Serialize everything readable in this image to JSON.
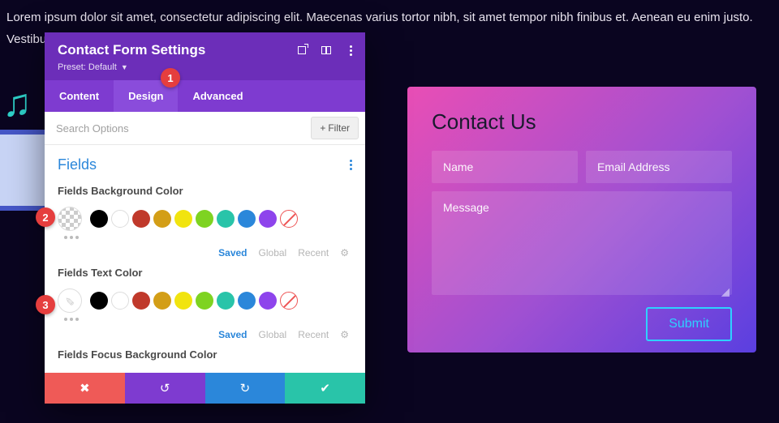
{
  "lorem": "Lorem ipsum dolor sit amet, consectetur adipiscing elit. Maecenas varius tortor nibh, sit amet tempor nibh finibus et. Aenean eu enim justo. Vestibulum aliquam hendrerit",
  "panel": {
    "title": "Contact Form Settings",
    "preset_label": "Preset:",
    "preset_value": "Default",
    "tabs": {
      "content": "Content",
      "design": "Design",
      "advanced": "Advanced"
    },
    "search_placeholder": "Search Options",
    "filter_label": "Filter",
    "section_title": "Fields",
    "fields_bg_label": "Fields Background Color",
    "fields_text_label": "Fields Text Color",
    "fields_focus_bg_label": "Fields Focus Background Color",
    "swatches": {
      "palette": [
        "#000000",
        "#ffffff",
        "#c0392b",
        "#d39e17",
        "#f1e40f",
        "#7ed321",
        "#29c4a9",
        "#2b87da",
        "#8e44ec"
      ]
    },
    "meta": {
      "saved": "Saved",
      "global": "Global",
      "recent": "Recent"
    }
  },
  "markers": {
    "m1": "1",
    "m2": "2",
    "m3": "3"
  },
  "preview": {
    "title": "Contact Us",
    "name_ph": "Name",
    "email_ph": "Email Address",
    "msg_ph": "Message",
    "submit": "Submit"
  }
}
